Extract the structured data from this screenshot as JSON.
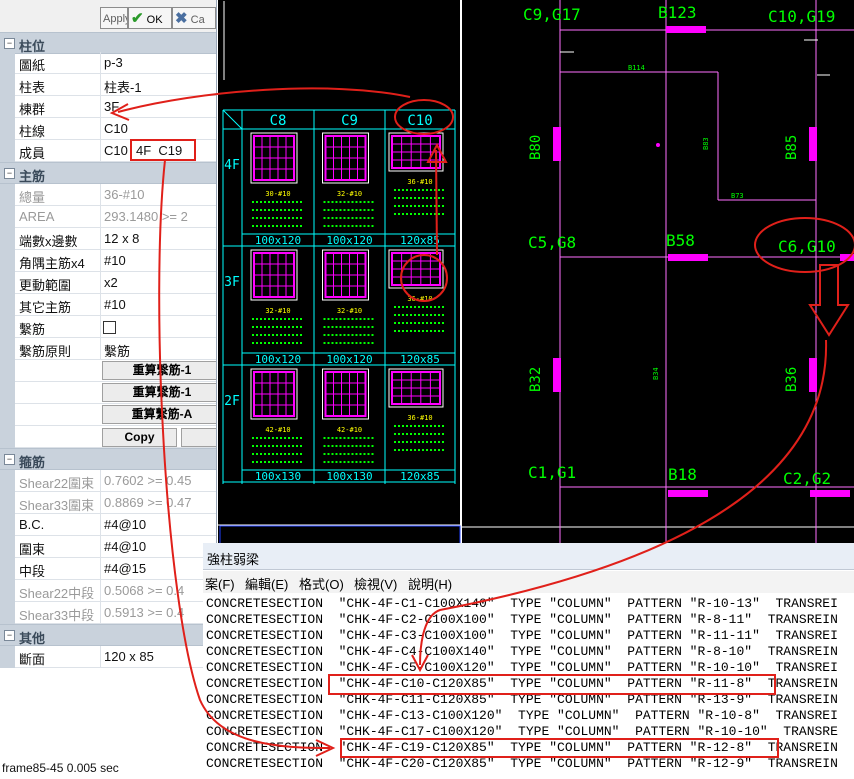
{
  "toolbar": {
    "apply_label": "Apply",
    "ok_label": "OK",
    "cancel_label": "Ca"
  },
  "grid": {
    "cat_column": "柱位",
    "rows_column": [
      {
        "key": "圖紙",
        "value": "p-3"
      },
      {
        "key": "柱表",
        "value": "柱表-1"
      },
      {
        "key": "棟群",
        "value": "3F"
      },
      {
        "key": "柱線",
        "value": "C10"
      },
      {
        "key": "成員",
        "value": "C10",
        "highlight": "4F  C19"
      }
    ],
    "cat_main": "主筋",
    "rows_main": [
      {
        "key": "總量",
        "value": "36-#10",
        "disabled": true
      },
      {
        "key": "AREA",
        "value": "293.1480  >=  2",
        "disabled": true
      },
      {
        "key": "端數x邊數",
        "value": "12 x 8"
      },
      {
        "key": "角隅主筋x4",
        "value": "#10"
      },
      {
        "key": "更動範圍",
        "value": "x2"
      },
      {
        "key": "其它主筋",
        "value": "#10"
      },
      {
        "key": "繫筋",
        "value": ""
      },
      {
        "key": "繫筋原則",
        "value": "繫筋"
      }
    ],
    "recalc_buttons": [
      "重算繫筋-1",
      "重算繫筋-1",
      "重算繫筋-A"
    ],
    "copy_label": "Copy",
    "cat_stirrup": "箍筋",
    "rows_stirrup": [
      {
        "key": "Shear22圍束",
        "value": "0.7602  >=  0.45",
        "disabled": true
      },
      {
        "key": "Shear33圍束",
        "value": "0.8869  >=  0.47",
        "disabled": true
      },
      {
        "key": "B.C.",
        "value": "#4@10"
      },
      {
        "key": "圍束",
        "value": "#4@10"
      },
      {
        "key": "中段",
        "value": "#4@15"
      },
      {
        "key": "Shear22中段",
        "value": "0.5068  >=  0.4",
        "disabled": true
      },
      {
        "key": "Shear33中段",
        "value": "0.5913  >=  0.4",
        "disabled": true
      }
    ],
    "cat_other": "其他",
    "rows_other": [
      {
        "key": "斷面",
        "value": "120 x 85"
      }
    ]
  },
  "status_text": "frame85-45  0.005 sec",
  "schedule": {
    "columns": [
      "C8",
      "C9",
      "C10"
    ],
    "floors": [
      "4F",
      "3F",
      "2F"
    ],
    "sizes": [
      [
        "100x120",
        "100x120",
        "120x85"
      ],
      [
        "100x120",
        "100x120",
        "120x85"
      ],
      [
        "100x130",
        "100x130",
        "120x85"
      ]
    ],
    "rebar_notes": [
      [
        "30-#10",
        "32-#10",
        "36-#10"
      ],
      [
        "32-#10",
        "32-#10",
        "36-#10"
      ],
      [
        "42-#10",
        "42-#10",
        "36-#10"
      ]
    ]
  },
  "plan": {
    "labels": [
      "C9,G17",
      "B123",
      "C10,G19",
      "B114",
      "B80",
      "B83",
      "B85",
      "B73",
      "C5,G8",
      "B58",
      "C6,G10",
      "B32",
      "B34",
      "B36",
      "C1,G1",
      "B18",
      "C2,G2"
    ]
  },
  "editor": {
    "window_title": "強柱弱梁",
    "menus": [
      "案(F)",
      "編輯(E)",
      "格式(O)",
      "檢視(V)",
      "說明(H)"
    ],
    "lines": [
      "CONCRETESECTION  \"CHK-4F-C1-C100X140\"  TYPE \"COLUMN\"  PATTERN \"R-10-13\"  TRANSREI",
      "CONCRETESECTION  \"CHK-4F-C2-C100X100\"  TYPE \"COLUMN\"  PATTERN \"R-8-11\"  TRANSREIN",
      "CONCRETESECTION  \"CHK-4F-C3-C100X100\"  TYPE \"COLUMN\"  PATTERN \"R-11-11\"  TRANSREI",
      "CONCRETESECTION  \"CHK-4F-C4-C100X140\"  TYPE \"COLUMN\"  PATTERN \"R-8-10\"  TRANSREIN",
      "CONCRETESECTION  \"CHK-4F-C5-C100X120\"  TYPE \"COLUMN\"  PATTERN \"R-10-10\"  TRANSREI",
      "CONCRETESECTION  \"CHK-4F-C10-C120X85\"  TYPE \"COLUMN\"  PATTERN \"R-11-8\"  TRANSREIN",
      "CONCRETESECTION  \"CHK-4F-C11-C120X85\"  TYPE \"COLUMN\"  PATTERN \"R-13-9\"  TRANSREIN",
      "CONCRETESECTION  \"CHK-4F-C13-C100X120\"  TYPE \"COLUMN\"  PATTERN \"R-10-8\"  TRANSREI",
      "CONCRETESECTION  \"CHK-4F-C17-C100X120\"  TYPE \"COLUMN\"  PATTERN \"R-10-10\"  TRANSRE",
      "CONCRETESECTION  \"CHK-4F-C19-C120X85\"  TYPE \"COLUMN\"  PATTERN \"R-12-8\"  TRANSREIN",
      "CONCRETESECTION  \"CHK-4F-C20-C120X85\"  TYPE \"COLUMN\"  PATTERN \"R-12-9\"  TRANSREIN"
    ]
  },
  "colors": {
    "cyan": "#00ffff",
    "magenta": "#ff00ff",
    "green": "#00ff00",
    "yellow": "#ffff00",
    "annotation_red": "#e0201a"
  }
}
